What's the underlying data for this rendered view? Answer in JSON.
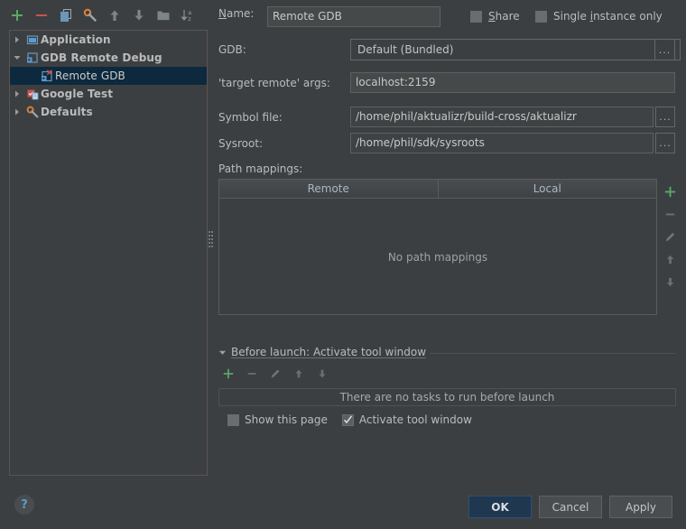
{
  "toolbar": {
    "buttons": [
      {
        "name": "add-configuration-button",
        "icon": "plus-icon"
      },
      {
        "name": "remove-configuration-button",
        "icon": "minus-icon"
      },
      {
        "name": "copy-configuration-button",
        "icon": "copy-icon"
      },
      {
        "name": "edit-templates-button",
        "icon": "wrench-icon"
      },
      {
        "name": "move-up-button",
        "icon": "arrow-up-icon"
      },
      {
        "name": "move-down-button",
        "icon": "arrow-down-icon"
      },
      {
        "name": "move-into-folder-button",
        "icon": "folder-icon"
      },
      {
        "name": "sort-configurations-button",
        "icon": "sort-az-icon"
      }
    ]
  },
  "tree": {
    "items": [
      {
        "label": "Application",
        "expanded": false,
        "bold": true,
        "icon": "application-icon",
        "indent": 0,
        "selected": false
      },
      {
        "label": "GDB Remote Debug",
        "expanded": true,
        "bold": true,
        "icon": "gdb-remote-icon",
        "indent": 0,
        "selected": false
      },
      {
        "label": "Remote GDB",
        "expanded": null,
        "bold": false,
        "icon": "gdb-config-icon",
        "indent": 1,
        "selected": true
      },
      {
        "label": "Google Test",
        "expanded": false,
        "bold": true,
        "icon": "google-test-icon",
        "indent": 0,
        "selected": false
      },
      {
        "label": "Defaults",
        "expanded": false,
        "bold": true,
        "icon": "defaults-wrench-icon",
        "indent": 0,
        "selected": false
      }
    ]
  },
  "form": {
    "name_label": "Name:",
    "name_value": "Remote GDB",
    "share_label": "Share",
    "share_checked": false,
    "single_instance_label": "Single instance only",
    "single_instance_checked": false,
    "gdb_label": "GDB:",
    "gdb_value": "Default (Bundled)",
    "gdb_browse_label": "...",
    "target_remote_label": "'target remote' args:",
    "target_remote_value": "localhost:2159",
    "symbol_file_label": "Symbol file:",
    "symbol_file_value": "/home/phil/aktualizr/build-cross/aktualizr",
    "symbol_file_browse_label": "...",
    "sysroot_label": "Sysroot:",
    "sysroot_value": "/home/phil/sdk/sysroots",
    "sysroot_browse_label": "...",
    "path_mappings_label": "Path mappings:"
  },
  "path_mappings_table": {
    "columns": [
      "Remote",
      "Local"
    ],
    "rows": [],
    "empty_text": "No path mappings",
    "side_buttons": [
      {
        "name": "add-path-mapping-button",
        "icon": "plus-icon",
        "enabled": true
      },
      {
        "name": "remove-path-mapping-button",
        "icon": "minus-icon",
        "enabled": false
      },
      {
        "name": "edit-path-mapping-button",
        "icon": "pencil-icon",
        "enabled": false
      },
      {
        "name": "move-path-mapping-up-button",
        "icon": "arrow-up-icon",
        "enabled": false
      },
      {
        "name": "move-path-mapping-down-button",
        "icon": "arrow-down-icon",
        "enabled": false
      }
    ]
  },
  "before_launch": {
    "title": "Before launch: Activate tool window",
    "expanded": true,
    "toolbar": [
      {
        "name": "add-task-button",
        "icon": "plus-icon",
        "enabled": true
      },
      {
        "name": "remove-task-button",
        "icon": "minus-icon",
        "enabled": false
      },
      {
        "name": "edit-task-button",
        "icon": "pencil-icon",
        "enabled": false
      },
      {
        "name": "move-task-up-button",
        "icon": "arrow-up-icon",
        "enabled": false
      },
      {
        "name": "move-task-down-button",
        "icon": "arrow-down-icon",
        "enabled": false
      }
    ],
    "empty_text": "There are no tasks to run before launch",
    "show_page_label": "Show this page",
    "show_page_checked": false,
    "activate_tool_window_label": "Activate tool window",
    "activate_tool_window_checked": true
  },
  "footer": {
    "help_label": "?",
    "ok_label": "OK",
    "cancel_label": "Cancel",
    "apply_label": "Apply"
  },
  "colors": {
    "background": "#3c3f41",
    "selection": "#0d293e",
    "text": "#bbbbbb",
    "accent_green": "#59a869",
    "accent_red": "#c75450",
    "accent_blue": "#5c9ccc",
    "primary_button": "#1f374f"
  }
}
